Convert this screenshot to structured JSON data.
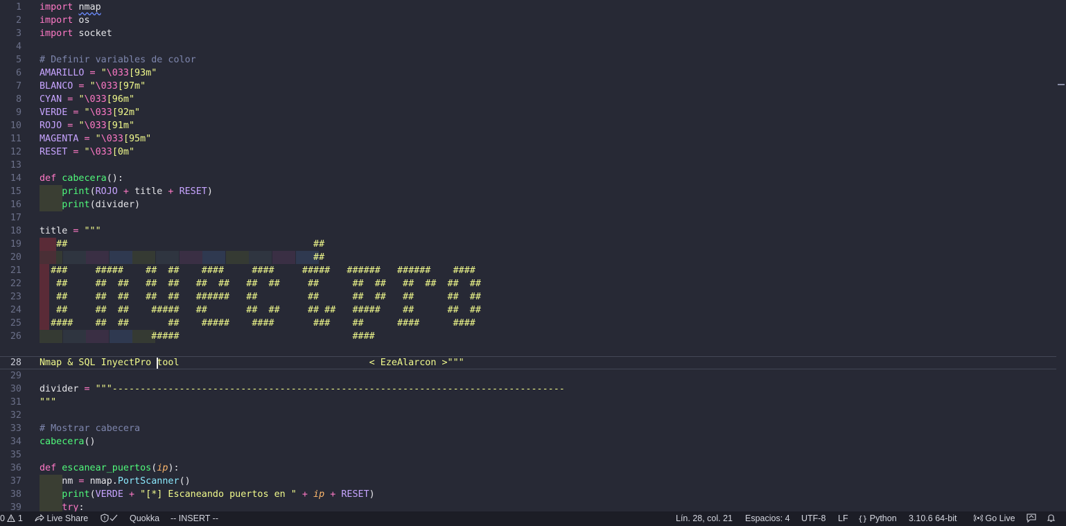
{
  "editor": {
    "language": "python",
    "cursor": {
      "line": 28,
      "col": 21
    },
    "lines": [
      {
        "n": "1",
        "tokens": [
          [
            "kw",
            "import"
          ],
          [
            "plain",
            " "
          ],
          [
            "plainsq",
            "nmap"
          ]
        ]
      },
      {
        "n": "2",
        "tokens": [
          [
            "kw",
            "import"
          ],
          [
            "plain",
            " os"
          ]
        ]
      },
      {
        "n": "3",
        "tokens": [
          [
            "kw",
            "import"
          ],
          [
            "plain",
            " socket"
          ]
        ]
      },
      {
        "n": "4",
        "tokens": []
      },
      {
        "n": "5",
        "tokens": [
          [
            "cmt",
            "# Definir variables de color"
          ]
        ]
      },
      {
        "n": "6",
        "tokens": [
          [
            "var",
            "AMARILLO"
          ],
          [
            "op",
            " = "
          ],
          [
            "str",
            "\""
          ],
          [
            "esc",
            "\\033"
          ],
          [
            "str",
            "[93m\""
          ]
        ]
      },
      {
        "n": "7",
        "tokens": [
          [
            "var",
            "BLANCO"
          ],
          [
            "op",
            " = "
          ],
          [
            "str",
            "\""
          ],
          [
            "esc",
            "\\033"
          ],
          [
            "str",
            "[97m\""
          ]
        ]
      },
      {
        "n": "8",
        "tokens": [
          [
            "var",
            "CYAN"
          ],
          [
            "op",
            " = "
          ],
          [
            "str",
            "\""
          ],
          [
            "esc",
            "\\033"
          ],
          [
            "str",
            "[96m\""
          ]
        ]
      },
      {
        "n": "9",
        "tokens": [
          [
            "var",
            "VERDE"
          ],
          [
            "op",
            " = "
          ],
          [
            "str",
            "\""
          ],
          [
            "esc",
            "\\033"
          ],
          [
            "str",
            "[92m\""
          ]
        ]
      },
      {
        "n": "10",
        "tokens": [
          [
            "var",
            "ROJO"
          ],
          [
            "op",
            " = "
          ],
          [
            "str",
            "\""
          ],
          [
            "esc",
            "\\033"
          ],
          [
            "str",
            "[91m\""
          ]
        ]
      },
      {
        "n": "11",
        "tokens": [
          [
            "var",
            "MAGENTA"
          ],
          [
            "op",
            " = "
          ],
          [
            "str",
            "\""
          ],
          [
            "esc",
            "\\033"
          ],
          [
            "str",
            "[95m\""
          ]
        ]
      },
      {
        "n": "12",
        "tokens": [
          [
            "var",
            "RESET"
          ],
          [
            "op",
            " = "
          ],
          [
            "str",
            "\""
          ],
          [
            "esc",
            "\\033"
          ],
          [
            "str",
            "[0m\""
          ]
        ]
      },
      {
        "n": "13",
        "tokens": []
      },
      {
        "n": "14",
        "tokens": [
          [
            "kw",
            "def"
          ],
          [
            "plain",
            " "
          ],
          [
            "fn",
            "cabecera"
          ],
          [
            "plain",
            "():"
          ]
        ]
      },
      {
        "n": "15",
        "guide": true,
        "tokens": [
          [
            "plain",
            "    "
          ],
          [
            "fn",
            "print"
          ],
          [
            "plain",
            "("
          ],
          [
            "var",
            "ROJO"
          ],
          [
            "op",
            " + "
          ],
          [
            "plain",
            "title"
          ],
          [
            "op",
            " + "
          ],
          [
            "var",
            "RESET"
          ],
          [
            "plain",
            ")"
          ]
        ]
      },
      {
        "n": "16",
        "guide": true,
        "tokens": [
          [
            "plain",
            "    "
          ],
          [
            "fn",
            "print"
          ],
          [
            "plain",
            "(divider)"
          ]
        ]
      },
      {
        "n": "17",
        "tokens": []
      },
      {
        "n": "18",
        "tokens": [
          [
            "plain",
            "title"
          ],
          [
            "op",
            " = "
          ],
          [
            "str",
            "\"\"\""
          ]
        ]
      },
      {
        "n": "19",
        "red": true,
        "tokens": [
          [
            "str",
            "   ##                                            ##"
          ]
        ]
      },
      {
        "n": "20",
        "blocks": true,
        "tokens": [
          [
            "str",
            "                                                 ##"
          ]
        ]
      },
      {
        "n": "21",
        "red": true,
        "tokens": [
          [
            "str",
            "  ###     #####    ##  ##    ####     ####     #####   ######   ######    ####"
          ]
        ]
      },
      {
        "n": "22",
        "red": true,
        "tokens": [
          [
            "str",
            "   ##     ##  ##   ##  ##   ##  ##   ##  ##     ##      ##  ##   ##  ##  ##  ##"
          ]
        ]
      },
      {
        "n": "23",
        "red": true,
        "tokens": [
          [
            "str",
            "   ##     ##  ##   ##  ##   ######   ##         ##      ##  ##   ##      ##  ##"
          ]
        ]
      },
      {
        "n": "24",
        "red": true,
        "tokens": [
          [
            "str",
            "   ##     ##  ##    #####   ##       ##  ##     ## ##   #####    ##      ##  ##"
          ]
        ]
      },
      {
        "n": "25",
        "red": true,
        "tokens": [
          [
            "str",
            "  ####    ##  ##       ##    #####    ####       ###    ##      ####      ####"
          ]
        ]
      },
      {
        "n": "26",
        "blocks6": true,
        "tokens": [
          [
            "str",
            "                    #####                               ####"
          ]
        ]
      },
      {
        "n": "28",
        "current": true,
        "tokens": [
          [
            "str",
            "Nmap & SQL InyectPro tool                                  < EzeAlarcon >\"\"\""
          ]
        ]
      },
      {
        "n": "29",
        "tokens": []
      },
      {
        "n": "30",
        "tokens": [
          [
            "plain",
            "divider"
          ],
          [
            "op",
            " = "
          ],
          [
            "str",
            "\"\"\"---------------------------------------------------------------------------------"
          ]
        ]
      },
      {
        "n": "31",
        "tokens": [
          [
            "str",
            "\"\"\""
          ]
        ]
      },
      {
        "n": "32",
        "tokens": []
      },
      {
        "n": "33",
        "tokens": [
          [
            "cmt",
            "# Mostrar cabecera"
          ]
        ]
      },
      {
        "n": "34",
        "tokens": [
          [
            "fn",
            "cabecera"
          ],
          [
            "plain",
            "()"
          ]
        ]
      },
      {
        "n": "35",
        "tokens": []
      },
      {
        "n": "36",
        "tokens": [
          [
            "kw",
            "def"
          ],
          [
            "plain",
            " "
          ],
          [
            "fn",
            "escanear_puertos"
          ],
          [
            "plain",
            "("
          ],
          [
            "param",
            "ip"
          ],
          [
            "plain",
            "):"
          ]
        ]
      },
      {
        "n": "37",
        "guide": true,
        "tokens": [
          [
            "plain",
            "    nm"
          ],
          [
            "op",
            " = "
          ],
          [
            "plain",
            "nmap."
          ],
          [
            "attr",
            "PortScanner"
          ],
          [
            "plain",
            "()"
          ]
        ]
      },
      {
        "n": "38",
        "guide": true,
        "tokens": [
          [
            "plain",
            "    "
          ],
          [
            "fn",
            "print"
          ],
          [
            "plain",
            "("
          ],
          [
            "var",
            "VERDE"
          ],
          [
            "op",
            " + "
          ],
          [
            "str",
            "\"[*] Escaneando puertos en \""
          ],
          [
            "op",
            " + "
          ],
          [
            "param",
            "ip"
          ],
          [
            "op",
            " + "
          ],
          [
            "var",
            "RESET"
          ],
          [
            "plain",
            ")"
          ]
        ]
      },
      {
        "n": "39",
        "guide": true,
        "tokens": [
          [
            "plain",
            "    "
          ],
          [
            "kw",
            "try"
          ],
          [
            "plain",
            ":"
          ]
        ]
      }
    ]
  },
  "statusbar": {
    "problems_errors": "0",
    "problems_warnings": "1",
    "live_share": "Live Share",
    "quokka": "Quokka",
    "mode": "-- INSERT --",
    "position": "Lín. 28, col. 21",
    "spaces": "Espacios: 4",
    "encoding": "UTF-8",
    "eol": "LF",
    "language": "Python",
    "interpreter": "3.10.6 64-bit",
    "go_live": "Go Live"
  },
  "colors": {
    "background": "#272935",
    "keyword": "#ff79c6",
    "function": "#50fa7b",
    "string": "#f1fa8c",
    "comment": "#7e86ad",
    "variable": "#c7a4ff",
    "parameter": "#ffb86c",
    "statusbar": "#1c1d26"
  }
}
